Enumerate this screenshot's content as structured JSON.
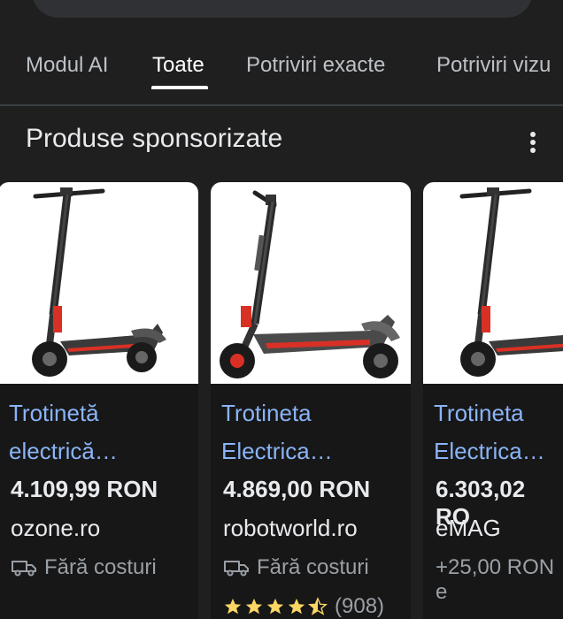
{
  "tabs": [
    {
      "label": "Modul AI",
      "active": false
    },
    {
      "label": "Toate",
      "active": true
    },
    {
      "label": "Potriviri exacte",
      "active": false
    },
    {
      "label": "Potriviri vizu",
      "active": false
    }
  ],
  "section": {
    "title": "Produse sponsorizate",
    "more_icon": "more-vert-icon"
  },
  "products": [
    {
      "title_line1": "Trotinetă",
      "title_line2": "electrică…",
      "price": "4.109,99 RON",
      "store": "ozone.ro",
      "shipping": "Fără costuri",
      "shipping_icon": "truck-icon"
    },
    {
      "title_line1": "Trotineta",
      "title_line2": "Electrica…",
      "price": "4.869,00 RON",
      "store": "robotworld.ro",
      "shipping": "Fără costuri",
      "shipping_icon": "truck-icon",
      "rating": 4.5,
      "rating_count": "(908)"
    },
    {
      "title_line1": "Trotineta",
      "title_line2": "Electrica…",
      "price": "6.303,02 RO",
      "store": "eMAG",
      "shipping": "+25,00 RON e"
    }
  ],
  "colors": {
    "background": "#1f1f1f",
    "link": "#8ab4f8",
    "star": "#fdd663",
    "accent_red": "#d93025"
  }
}
